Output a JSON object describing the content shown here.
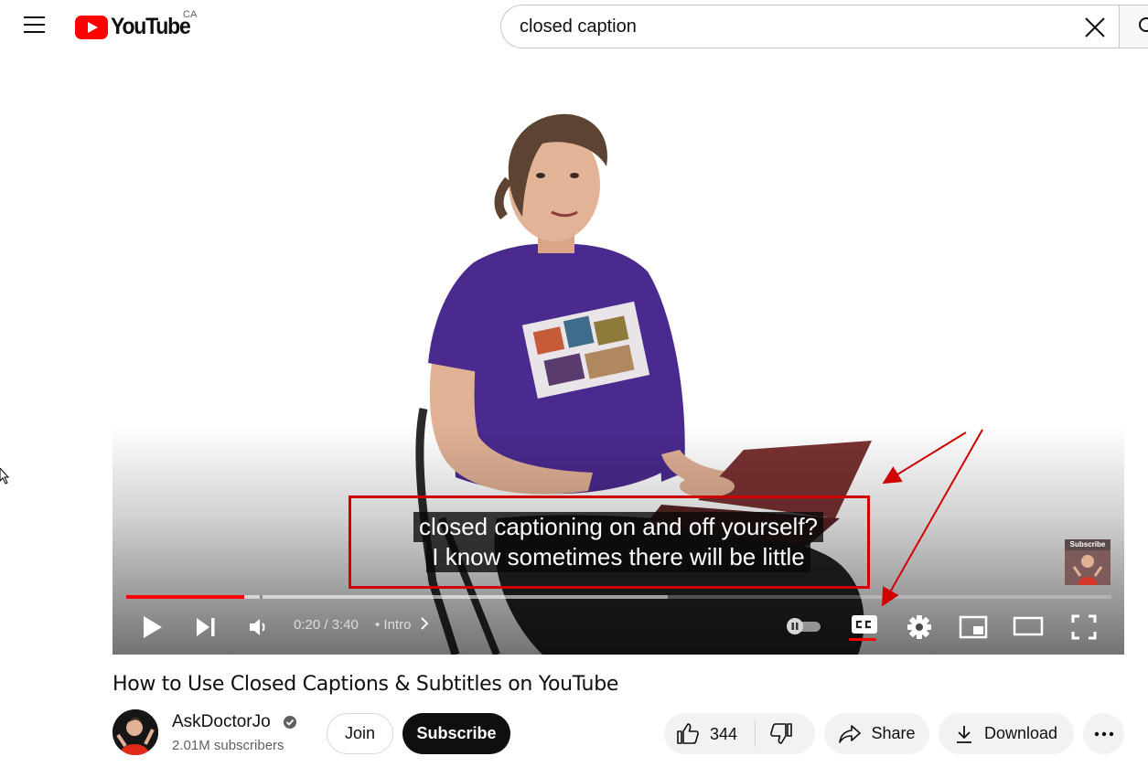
{
  "header": {
    "logo_text": "YouTube",
    "region": "CA",
    "search": {
      "value": "closed caption",
      "placeholder": "Search"
    }
  },
  "player": {
    "captions": [
      "closed captioning on and off yourself?",
      "I know sometimes there will be little"
    ],
    "endscreen_label": "Subscribe",
    "time": "0:20 / 3:40",
    "chapter": "Intro",
    "progress": {
      "played_fraction": 0.12,
      "buffered_fraction": 0.55
    },
    "cc_enabled": true,
    "autoplay_enabled": false
  },
  "video": {
    "title": "How to Use Closed Captions & Subtitles on YouTube",
    "channel_name": "AskDoctorJo",
    "subscribers": "2.01M subscribers",
    "join_label": "Join",
    "subscribe_label": "Subscribe",
    "like_count": "344",
    "share_label": "Share",
    "download_label": "Download"
  },
  "colors": {
    "brand_red": "#ff0000",
    "annotation_red": "#d10000",
    "subscribe_bg": "#0f0f0f",
    "pill_bg": "#f2f2f2"
  },
  "icons": [
    "menu-icon",
    "youtube-logo-icon",
    "clear-icon",
    "search-icon",
    "play-icon",
    "next-icon",
    "volume-icon",
    "chevron-right-icon",
    "autoplay-toggle-icon",
    "cc-icon",
    "gear-icon",
    "miniplayer-icon",
    "theater-icon",
    "fullscreen-icon",
    "verified-icon",
    "thumbs-up-icon",
    "thumbs-down-icon",
    "share-icon",
    "download-icon",
    "more-icon"
  ]
}
